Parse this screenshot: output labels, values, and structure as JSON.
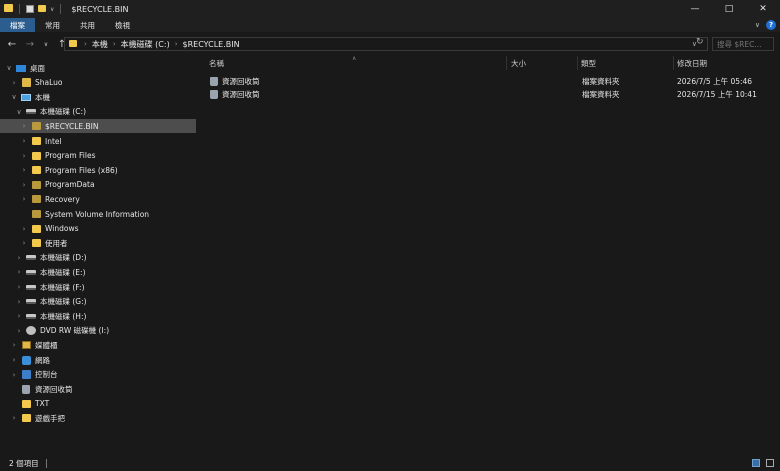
{
  "window": {
    "title": "$RECYCLE.BIN",
    "quick_access_dropdown": "∨",
    "minimize": "—",
    "maximize": "□",
    "close": "✕"
  },
  "ribbon": {
    "tabs": [
      {
        "label": "檔案",
        "active": true
      },
      {
        "label": "常用",
        "active": false
      },
      {
        "label": "共用",
        "active": false
      },
      {
        "label": "檢視",
        "active": false
      }
    ],
    "expand": "∨",
    "help": "?"
  },
  "address": {
    "breadcrumbs": [
      "本機",
      "本機磁碟 (C:)",
      "$RECYCLE.BIN"
    ],
    "search_placeholder": "搜尋 $REC..."
  },
  "nav_tree": [
    {
      "label": "桌面",
      "icon": "desktop-icon",
      "chev": "expanded",
      "indent": 0
    },
    {
      "label": "ShaLuo",
      "icon": "user-folder-icon",
      "chev": "collapsed",
      "indent": 1
    },
    {
      "label": "本機",
      "icon": "this-pc-icon",
      "chev": "expanded",
      "indent": 1
    },
    {
      "label": "本機磁碟 (C:)",
      "icon": "drive-icon",
      "chev": "expanded",
      "indent": 2
    },
    {
      "label": "$RECYCLE.BIN",
      "icon": "folder-icon",
      "chev": "collapsed",
      "indent": 3,
      "selected": true,
      "dim": true
    },
    {
      "label": "Intel",
      "icon": "folder-icon",
      "chev": "collapsed",
      "indent": 3
    },
    {
      "label": "Program Files",
      "icon": "folder-icon",
      "chev": "collapsed",
      "indent": 3
    },
    {
      "label": "Program Files (x86)",
      "icon": "folder-icon",
      "chev": "collapsed",
      "indent": 3
    },
    {
      "label": "ProgramData",
      "icon": "folder-icon",
      "chev": "collapsed",
      "indent": 3,
      "dim": true
    },
    {
      "label": "Recovery",
      "icon": "folder-icon",
      "chev": "collapsed",
      "indent": 3,
      "dim": true
    },
    {
      "label": "System Volume Information",
      "icon": "folder-icon",
      "chev": "none",
      "indent": 3,
      "dim": true
    },
    {
      "label": "Windows",
      "icon": "folder-icon",
      "chev": "collapsed",
      "indent": 3
    },
    {
      "label": "使用者",
      "icon": "folder-icon",
      "chev": "collapsed",
      "indent": 3
    },
    {
      "label": "本機磁碟 (D:)",
      "icon": "drive-icon",
      "chev": "collapsed",
      "indent": 2
    },
    {
      "label": "本機磁碟 (E:)",
      "icon": "drive-icon",
      "chev": "collapsed",
      "indent": 2
    },
    {
      "label": "本機磁碟 (F:)",
      "icon": "drive-icon",
      "chev": "collapsed",
      "indent": 2
    },
    {
      "label": "本機磁碟 (G:)",
      "icon": "drive-icon",
      "chev": "collapsed",
      "indent": 2
    },
    {
      "label": "本機磁碟 (H:)",
      "icon": "drive-icon",
      "chev": "collapsed",
      "indent": 2
    },
    {
      "label": "DVD RW 磁碟機 (I:)",
      "icon": "dvd-drive-icon",
      "chev": "collapsed",
      "indent": 2
    },
    {
      "label": "媒體櫃",
      "icon": "library-icon",
      "chev": "collapsed",
      "indent": 1
    },
    {
      "label": "網路",
      "icon": "network-icon",
      "chev": "collapsed",
      "indent": 1
    },
    {
      "label": "控制台",
      "icon": "control-panel-icon",
      "chev": "collapsed",
      "indent": 1
    },
    {
      "label": "資源回收筒",
      "icon": "recycle-bin-icon",
      "chev": "none",
      "indent": 1
    },
    {
      "label": "TXT",
      "icon": "folder-icon",
      "chev": "none",
      "indent": 1
    },
    {
      "label": "遊戲手把",
      "icon": "folder-icon",
      "chev": "collapsed",
      "indent": 1
    }
  ],
  "columns": [
    {
      "label": "名稱"
    },
    {
      "label": "大小"
    },
    {
      "label": "類型"
    },
    {
      "label": "修改日期"
    }
  ],
  "sort_indicator": "∧",
  "files": [
    {
      "name": "資源回收筒",
      "size": "",
      "type": "檔案資料夾",
      "modified": "2026/7/5 上午 05:46",
      "icon": "recycle-bin-icon"
    },
    {
      "name": "資源回收筒",
      "size": "",
      "type": "檔案資料夾",
      "modified": "2026/7/15 上午 10:41",
      "icon": "recycle-bin-icon"
    }
  ],
  "status": {
    "item_count": "2 個項目"
  }
}
